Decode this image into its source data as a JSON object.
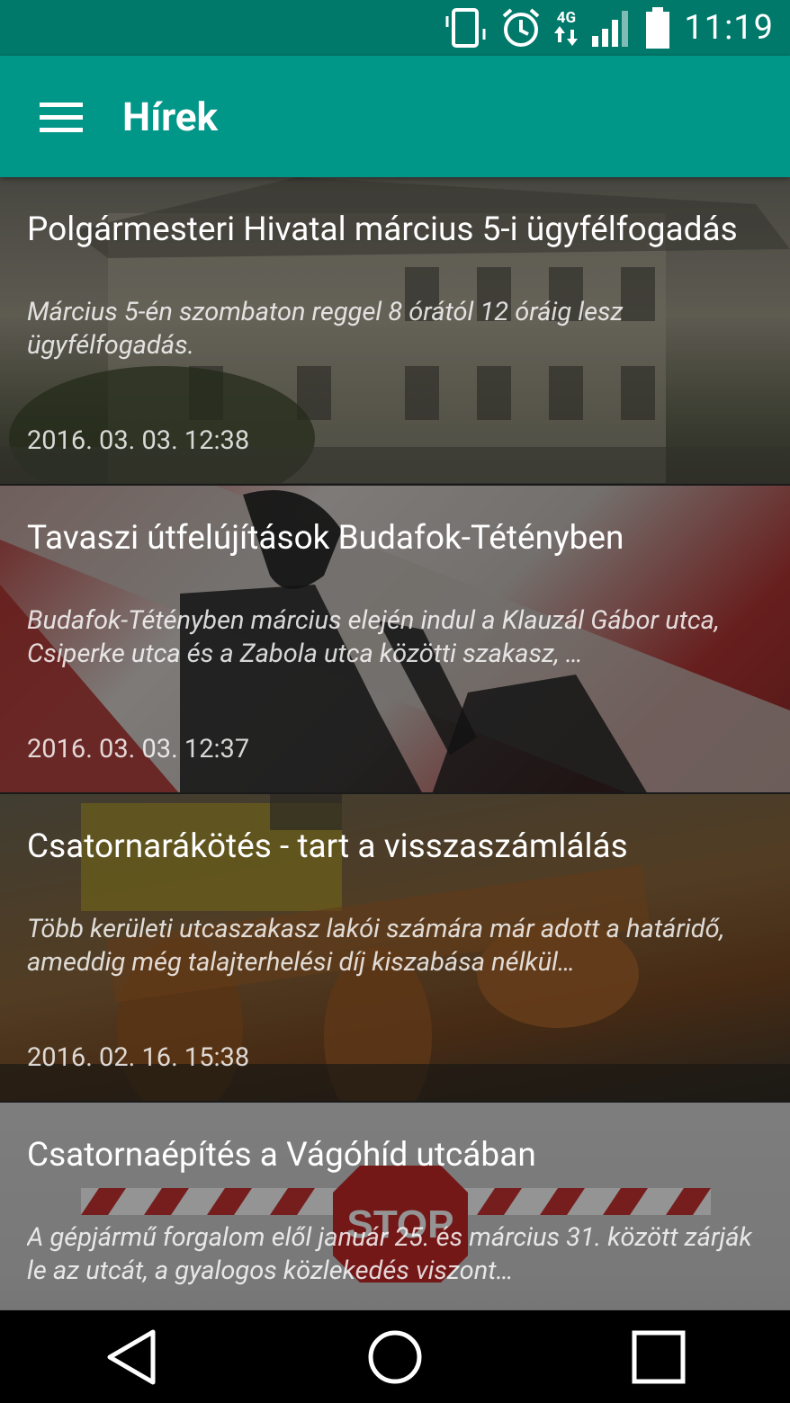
{
  "status_bar": {
    "network_label": "4G",
    "time": "11:19",
    "icons": [
      "vibrate-icon",
      "alarm-icon",
      "network-4g-icon",
      "signal-icon",
      "battery-icon"
    ]
  },
  "app_bar": {
    "title": "Hírek",
    "menu_icon": "hamburger-menu-icon",
    "color": "#009688",
    "status_color": "#00796b"
  },
  "news": [
    {
      "title": "Polgármesteri Hivatal március 5-i ügyfélfogadás",
      "excerpt": "Március 5-én szombaton reggel 8 órától 12 óráig lesz ügyfélfogadás.",
      "date": "2016. 03. 03. 12:38"
    },
    {
      "title": "Tavaszi útfelújítások Budafok-Tétényben",
      "excerpt": "Budafok-Tétényben március elején indul a Klauzál Gábor utca, Csiperke utca és a Zabola utca közötti szakasz, …",
      "date": "2016. 03. 03. 12:37"
    },
    {
      "title": "Csatornarákötés - tart a visszaszámlálás",
      "excerpt": "Több kerületi utcaszakasz lakói számára már adott a határidő, ameddig még talajterhelési díj kiszabása nélkül…",
      "date": "2016. 02. 16. 15:38"
    },
    {
      "title": "Csatornaépítés a Vágóhíd utcában",
      "excerpt": "A gépjármű forgalom elől január 25. és március 31. között zárják le az utcát, a gyalogos közlekedés viszont…",
      "date": ""
    }
  ],
  "nav_bar": {
    "icons": [
      "back-triangle-icon",
      "home-circle-icon",
      "recents-square-icon"
    ]
  }
}
